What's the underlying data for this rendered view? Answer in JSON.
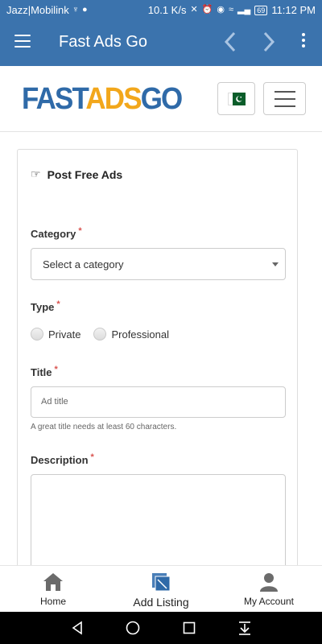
{
  "status_bar": {
    "carrier": "Jazz|Mobilink",
    "speed": "10.1 K/s",
    "battery": "69",
    "time": "11:12 PM"
  },
  "app_bar": {
    "title": "Fast Ads Go"
  },
  "site_header": {
    "logo_fast": "FAST",
    "logo_ads": "ADS",
    "logo_go": "GO"
  },
  "form": {
    "title": "Post Free Ads",
    "category_label": "Category",
    "category_select_value": "Select a category",
    "type_label": "Type",
    "type_options": [
      "Private",
      "Professional"
    ],
    "title_label": "Title",
    "title_placeholder": "Ad title",
    "title_help": "A great title needs at least 60 characters.",
    "description_label": "Description",
    "required_mark": "*"
  },
  "bottom_nav": {
    "items": [
      {
        "label": "Home",
        "icon": "home-icon"
      },
      {
        "label": "Add Listing",
        "icon": "add-listing-icon"
      },
      {
        "label": "My Account",
        "icon": "account-icon"
      }
    ]
  },
  "colors": {
    "app_bar": "#3b73ad",
    "logo_blue": "#2f6aa8",
    "logo_orange": "#f2a71b",
    "required": "#d9534f"
  }
}
